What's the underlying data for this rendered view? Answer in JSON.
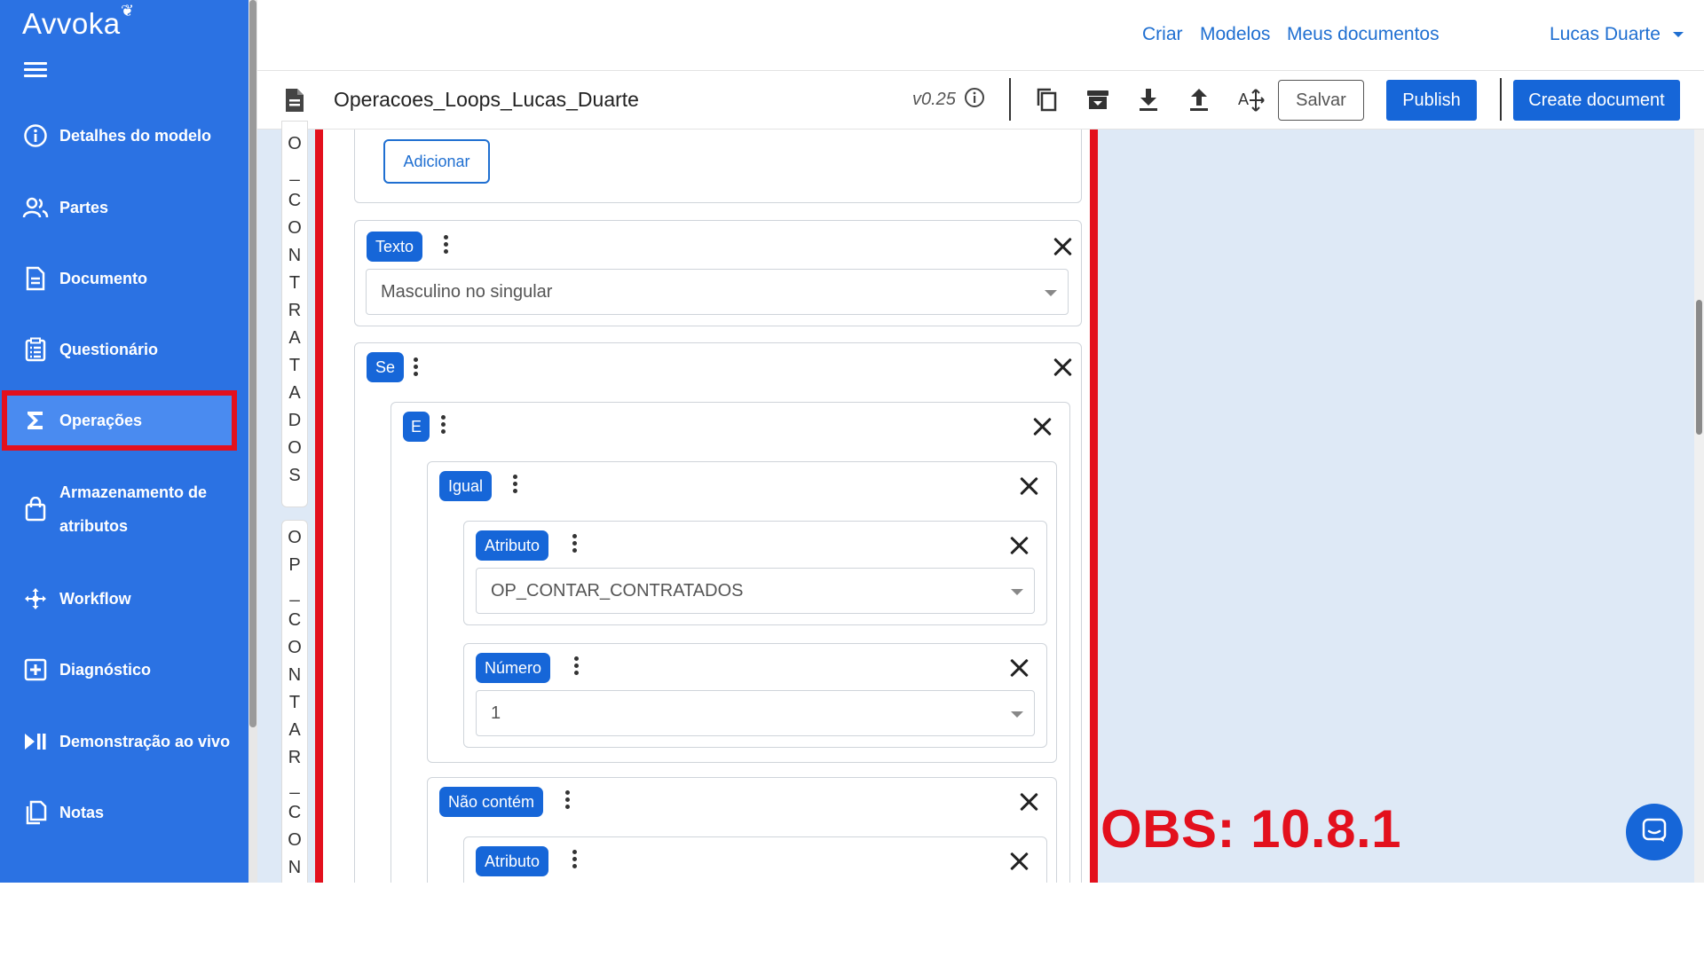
{
  "app": {
    "brand": "Avvoka",
    "accent_color": "#2b72e3",
    "highlight_color": "#e3101d"
  },
  "sidebar": {
    "items": [
      {
        "label": "Detalhes do modelo",
        "icon": "info-circle-icon"
      },
      {
        "label": "Partes",
        "icon": "users-icon"
      },
      {
        "label": "Documento",
        "icon": "document-icon"
      },
      {
        "label": "Questionário",
        "icon": "clipboard-list-icon"
      },
      {
        "label": "Operações",
        "icon": "sigma-icon",
        "active": true
      },
      {
        "label_line1": "Armazenamento de",
        "label_line2": "atributos",
        "icon": "shopping-bag-icon"
      },
      {
        "label": "Workflow",
        "icon": "workflow-icon"
      },
      {
        "label": "Diagnóstico",
        "icon": "plus-square-icon"
      },
      {
        "label": "Demonstração ao vivo",
        "icon": "play-pause-icon"
      },
      {
        "label": "Notas",
        "icon": "copy-notes-icon"
      }
    ]
  },
  "topnav": {
    "criar": "Criar",
    "modelos": "Modelos",
    "meus_documentos": "Meus documentos",
    "user": "Lucas Duarte"
  },
  "toolbar": {
    "document_title": "Operacoes_Loops_Lucas_Duarte",
    "version": "v0.25",
    "save_label": "Salvar",
    "publish_label": "Publish",
    "create_document_label": "Create document"
  },
  "vertical_labels": {
    "group1": [
      "O",
      "_",
      "C",
      "O",
      "N",
      "T",
      "R",
      "A",
      "T",
      "A",
      "D",
      "O",
      "S"
    ],
    "group2": [
      "O",
      "P",
      "_",
      "C",
      "O",
      "N",
      "T",
      "A",
      "R",
      "_",
      "C",
      "O",
      "N"
    ]
  },
  "editor": {
    "add_button": "Adicionar",
    "texto_block": {
      "tag": "Texto",
      "value": "Masculino no singular"
    },
    "se_block": {
      "tag": "Se"
    },
    "e_block": {
      "tag": "E"
    },
    "igual_block": {
      "tag": "Igual"
    },
    "atributo1": {
      "tag": "Atributo",
      "value": "OP_CONTAR_CONTRATADOS"
    },
    "numero": {
      "tag": "Número",
      "value": "1"
    },
    "nao_contem": {
      "tag": "Não contém"
    },
    "atributo2": {
      "tag": "Atributo"
    }
  },
  "annotation": {
    "obs": "OBS: 10.8.1"
  }
}
